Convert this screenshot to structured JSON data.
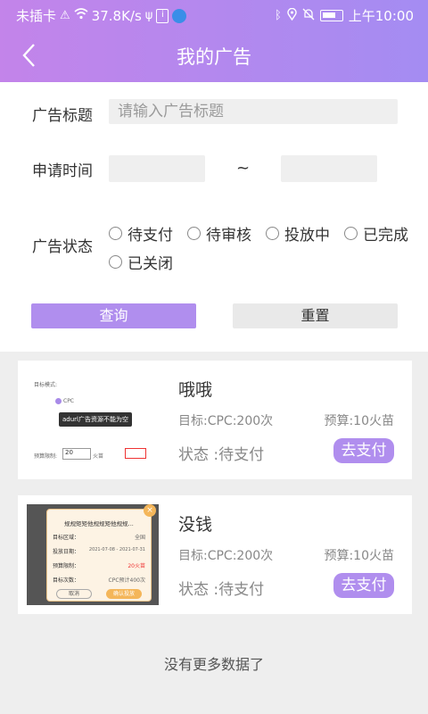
{
  "status_bar": {
    "carrier": "未插卡",
    "speed": "37.8K/s",
    "time": "上午10:00"
  },
  "header": {
    "title": "我的广告"
  },
  "form": {
    "title_label": "广告标题",
    "title_placeholder": "请输入广告标题",
    "time_label": "申请时间",
    "time_separator": "~",
    "status_label": "广告状态",
    "status_options": [
      "待支付",
      "待审核",
      "投放中",
      "已完成",
      "已关闭"
    ],
    "query_label": "查询",
    "reset_label": "重置"
  },
  "ads": [
    {
      "name": "哦哦",
      "target": "目标:CPC:200次",
      "budget": "预算:10火苗",
      "status": "状态 :待支付",
      "action": "去支付",
      "thumb_text": {
        "mode_label": "目标模式:",
        "cpc": "CPC",
        "tip": "adurl广告资源不能为空",
        "budget_label": "预算限制:",
        "budget_value": "20",
        "unit": "火苗"
      }
    },
    {
      "name": "没钱",
      "target": "目标:CPC:200次",
      "budget": "预算:10火苗",
      "status": "状态 :待支付",
      "action": "去支付",
      "thumb_text": {
        "headline": "规规矩矩他规规矩他规规...",
        "region_label": "目标区域：",
        "region_value": "全国",
        "date_label": "投放日期：",
        "date_value": "2021-07-08 - 2021-07-31",
        "budget_label": "预算限制：",
        "budget_value": "20火苗",
        "count_label": "目标次数：",
        "count_value": "CPC预计400次",
        "cancel": "取消",
        "confirm": "确认投放"
      }
    }
  ],
  "footer": {
    "no_more": "没有更多数据了"
  },
  "colors": {
    "accent": "#b08eee",
    "header_start": "#c384ea",
    "header_end": "#a48cf2"
  }
}
